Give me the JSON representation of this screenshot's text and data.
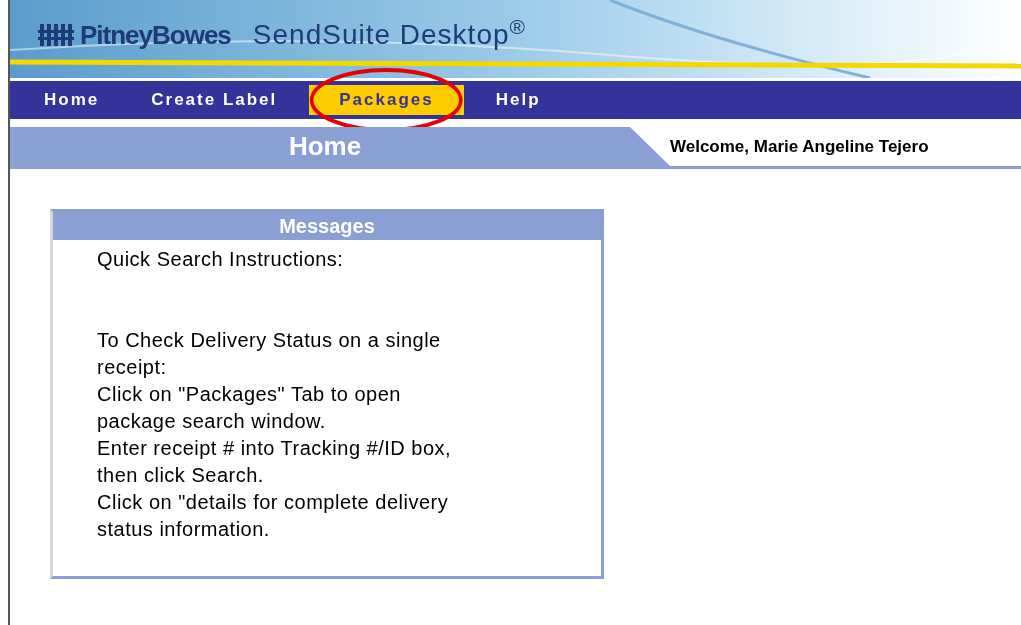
{
  "banner": {
    "brand": "PitneyBowes",
    "product": "SendSuite Desktop$^{®}$"
  },
  "tabs": [
    {
      "label": "Home",
      "selected": false,
      "circled": false
    },
    {
      "label": "Create Label",
      "selected": false,
      "circled": false
    },
    {
      "label": "Packages",
      "selected": true,
      "circled": true
    },
    {
      "label": "Help",
      "selected": false,
      "circled": false
    }
  ],
  "page_title": "Home",
  "welcome": "Welcome, Marie Angeline Tejero",
  "messages": {
    "title": "Messages",
    "heading": "Quick Search Instructions:",
    "lines": [
      "To Check Delivery Status on a single receipt:",
      "Click on \"Packages\" Tab to open package search window.",
      "Enter receipt # into Tracking #/ID box, then click Search.",
      "Click on \"details for complete delivery status information."
    ]
  }
}
